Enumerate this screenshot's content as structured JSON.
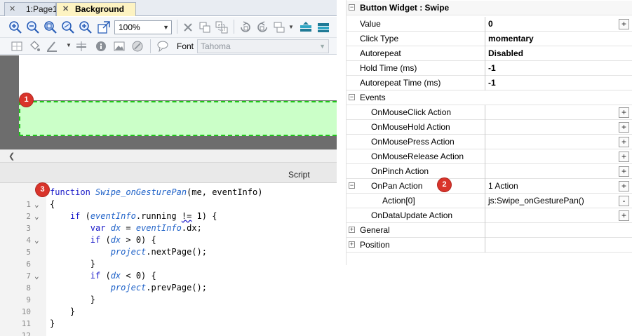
{
  "tabs": [
    {
      "label": "1:Page1",
      "active": false
    },
    {
      "label": "Background",
      "active": true
    }
  ],
  "toolbar": {
    "zoom_value": "100%",
    "font_label": "Font",
    "font_value": "Tahoma"
  },
  "script_panel": {
    "title": "Script",
    "lines": [
      {
        "n": "1",
        "fold": ""
      },
      {
        "n": "2",
        "fold": "⌄"
      },
      {
        "n": "3",
        "fold": "⌄"
      },
      {
        "n": "4",
        "fold": ""
      },
      {
        "n": "5",
        "fold": "⌄"
      },
      {
        "n": "6",
        "fold": ""
      },
      {
        "n": "7",
        "fold": ""
      },
      {
        "n": "8",
        "fold": "⌄"
      },
      {
        "n": "9",
        "fold": ""
      },
      {
        "n": "10",
        "fold": ""
      },
      {
        "n": "11",
        "fold": ""
      },
      {
        "n": "12",
        "fold": ""
      }
    ],
    "code": {
      "l1_kw": "function",
      "l1_fn": "Swipe_onGesturePan",
      "l1_rest": "(me, eventInfo)",
      "l2": "{",
      "l3_kw": "if",
      "l3_a": " (",
      "l3_obj": "eventInfo",
      "l3_b": ".running ",
      "l3_op": "!=",
      "l3_c": " 1) {",
      "l4_kw": "var",
      "l4_sp": " ",
      "l4_var": "dx",
      "l4_eq": " = ",
      "l4_obj": "eventInfo",
      "l4_rest": ".dx;",
      "l5_kw": "if",
      "l5_a": " (",
      "l5_var": "dx",
      "l5_rest": " > 0) {",
      "l6_obj": "project",
      "l6_rest": ".nextPage();",
      "l7": "}",
      "l8_kw": "if",
      "l8_a": " (",
      "l8_var": "dx",
      "l8_rest": " < 0) {",
      "l9_obj": "project",
      "l9_rest": ".prevPage();",
      "l10": "}",
      "l11": "}",
      "l12": "}"
    }
  },
  "badges": {
    "b1": "1",
    "b2": "2",
    "b3": "3"
  },
  "properties": {
    "title": "Button Widget : Swipe",
    "rows": [
      {
        "name": "Value",
        "value": "0",
        "bold": true,
        "button": "+"
      },
      {
        "name": "Click Type",
        "value": "momentary",
        "bold": true,
        "button": ""
      },
      {
        "name": "Autorepeat",
        "value": "Disabled",
        "bold": true,
        "button": ""
      },
      {
        "name": "Hold Time (ms)",
        "value": "-1",
        "bold": true,
        "button": ""
      },
      {
        "name": "Autorepeat Time (ms)",
        "value": "-1",
        "bold": true,
        "button": ""
      },
      {
        "name": "Events",
        "value": "",
        "bold": false,
        "button": ""
      },
      {
        "name": "OnMouseClick Action",
        "value": "",
        "bold": false,
        "button": "+"
      },
      {
        "name": "OnMouseHold Action",
        "value": "",
        "bold": false,
        "button": "+"
      },
      {
        "name": "OnMousePress Action",
        "value": "",
        "bold": false,
        "button": "+"
      },
      {
        "name": "OnMouseRelease Action",
        "value": "",
        "bold": false,
        "button": "+"
      },
      {
        "name": "OnPinch Action",
        "value": "",
        "bold": false,
        "button": "+"
      },
      {
        "name": "OnPan Action",
        "value": "1 Action",
        "bold": false,
        "button": "+"
      },
      {
        "name": "Action[0]",
        "value": "js:Swipe_onGesturePan()",
        "bold": false,
        "button": "-"
      },
      {
        "name": "OnDataUpdate Action",
        "value": "",
        "bold": false,
        "button": "+"
      },
      {
        "name": "General",
        "value": "",
        "bold": false,
        "button": ""
      },
      {
        "name": "Position",
        "value": "",
        "bold": false,
        "button": ""
      }
    ],
    "expanders": {
      "title": "−",
      "events": "−",
      "onpan": "−",
      "general": "+",
      "position": "+"
    }
  },
  "colors": {
    "widget_fill": "#cbffc8",
    "widget_border": "#1fc41a",
    "canvas_bg": "#6d6d6d",
    "badge": "#d9342b",
    "keyword": "#1818c8"
  }
}
